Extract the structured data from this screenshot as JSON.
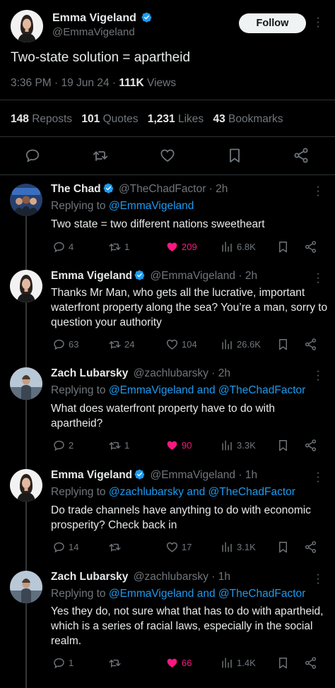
{
  "main_tweet": {
    "author_name": "Emma Vigeland",
    "author_handle": "@EmmaVigeland",
    "follow_label": "Follow",
    "text": "Two-state solution = apartheid",
    "time": "3:36 PM · 19 Jun 24 · ",
    "views_count": "111K",
    "views_label": " Views",
    "stats": {
      "reposts_count": "148",
      "reposts_label": "Reposts",
      "quotes_count": "101",
      "quotes_label": "Quotes",
      "likes_count": "1,231",
      "likes_label": "Likes",
      "bookmarks_count": "43",
      "bookmarks_label": "Bookmarks"
    }
  },
  "replies": [
    {
      "name": "The Chad",
      "handle": "@TheChadFactor",
      "time": " · 2h",
      "replying_prefix": "Replying to ",
      "replying_to": "@EmmaVigeland",
      "text": "Two state = two different nations sweetheart",
      "reply_count": "4",
      "repost_count": "1",
      "like_count": "209",
      "view_count": "6.8K",
      "liked": true
    },
    {
      "name": "Emma Vigeland",
      "handle": "@EmmaVigeland",
      "time": " · 2h",
      "text": "Thanks Mr Man, who gets all the lucrative, important waterfront property along the sea? You’re a man, sorry to question your authority",
      "reply_count": "63",
      "repost_count": "24",
      "like_count": "104",
      "view_count": "26.6K",
      "liked": false
    },
    {
      "name": "Zach Lubarsky",
      "handle": "@zachlubarsky",
      "time": " · 2h",
      "replying_prefix": "Replying to ",
      "replying_to": "@EmmaVigeland and @TheChadFactor",
      "text": "What does waterfront property have to do with apartheid?",
      "reply_count": "2",
      "repost_count": "1",
      "like_count": "90",
      "view_count": "3.3K",
      "liked": true
    },
    {
      "name": "Emma Vigeland",
      "handle": "@EmmaVigeland",
      "time": " · 1h",
      "replying_prefix": "Replying to ",
      "replying_to": "@zachlubarsky and @TheChadFactor",
      "text": "Do trade channels have anything to do with economic prosperity? Check back in",
      "reply_count": "14",
      "repost_count": "",
      "like_count": "17",
      "view_count": "3.1K",
      "liked": false
    },
    {
      "name": "Zach Lubarsky",
      "handle": "@zachlubarsky",
      "time": " · 1h",
      "replying_prefix": "Replying to ",
      "replying_to": "@EmmaVigeland and @TheChadFactor",
      "text": "Yes they do, not sure what that has to do with apartheid, which is a series of racial laws, especially in the social realm.",
      "reply_count": "1",
      "repost_count": "",
      "like_count": "66",
      "view_count": "1.4K",
      "liked": true
    }
  ],
  "colors": {
    "background": "#000000",
    "accent": "#1d9bf0",
    "like": "#f91880",
    "muted": "#71767b",
    "text": "#e7e9ea"
  },
  "icons": [
    "verified-badge-icon",
    "more-icon",
    "reply-icon",
    "repost-icon",
    "like-icon",
    "views-icon",
    "bookmark-icon",
    "share-icon"
  ]
}
